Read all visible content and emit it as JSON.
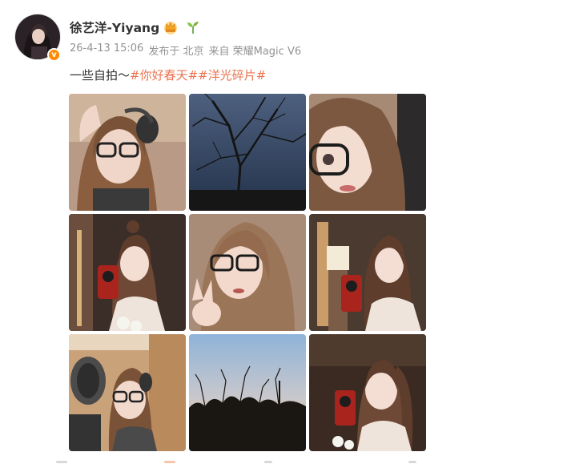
{
  "post": {
    "author": {
      "name": "徐艺洋-Yiyang",
      "avatar_icon": "profile-photo",
      "verified_icon": "verified-v-badge",
      "verified_color": "#ff8a00",
      "badges": [
        "crown-fan-badge-icon",
        "sprout-badge-icon"
      ]
    },
    "meta": {
      "timestamp": "26-4-13 15:06",
      "location": "发布于 北京",
      "source": "来自 荣耀Magic V6"
    },
    "content": {
      "text": "一些自拍～",
      "hashtags": [
        "#你好春天#",
        "#洋光碎片#"
      ],
      "hashtag_color": "#eb7350"
    },
    "photos": [
      {
        "name": "selfie-with-headphones-and-glasses"
      },
      {
        "name": "bare-tree-branches-evening-sky"
      },
      {
        "name": "selfie-glasses-closeup"
      },
      {
        "name": "mirror-selfie-red-phone"
      },
      {
        "name": "selfie-glasses-peace-sign"
      },
      {
        "name": "mirror-selfie-red-phone-restaurant"
      },
      {
        "name": "studio-selfie-headphones-microphone"
      },
      {
        "name": "sunset-tree-silhouette"
      },
      {
        "name": "mirror-selfie-ponytail-red-phone"
      }
    ]
  }
}
